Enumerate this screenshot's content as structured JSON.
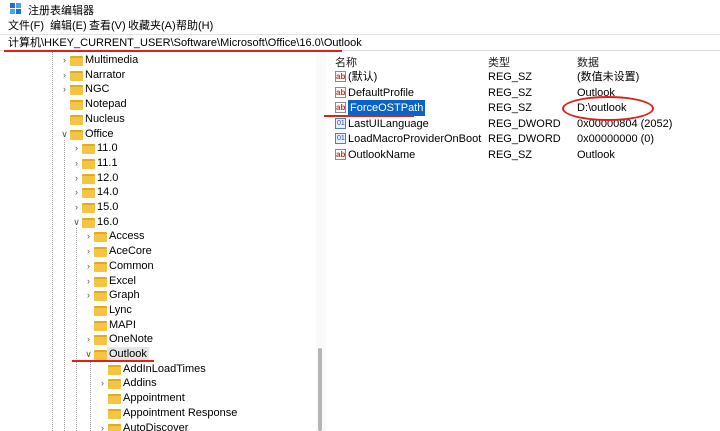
{
  "window": {
    "title": "注册表编辑器"
  },
  "menu": [
    "文件(F)",
    "编辑(E)",
    "查看(V)",
    "收藏夹(A)",
    "帮助(H)"
  ],
  "address": {
    "path": "计算机\\HKEY_CURRENT_USER\\Software\\Microsoft\\Office\\16.0\\Outlook"
  },
  "tree": {
    "items": [
      {
        "label": "Multimedia",
        "level": 0,
        "expanded": false,
        "has_children": true
      },
      {
        "label": "Narrator",
        "level": 0,
        "expanded": false,
        "has_children": true
      },
      {
        "label": "NGC",
        "level": 0,
        "expanded": false,
        "has_children": true
      },
      {
        "label": "Notepad",
        "level": 0,
        "expanded": false,
        "has_children": false
      },
      {
        "label": "Nucleus",
        "level": 0,
        "expanded": false,
        "has_children": false
      },
      {
        "label": "Office",
        "level": 0,
        "expanded": true,
        "has_children": true
      },
      {
        "label": "11.0",
        "level": 1,
        "expanded": false,
        "has_children": true
      },
      {
        "label": "11.1",
        "level": 1,
        "expanded": false,
        "has_children": true
      },
      {
        "label": "12.0",
        "level": 1,
        "expanded": false,
        "has_children": true
      },
      {
        "label": "14.0",
        "level": 1,
        "expanded": false,
        "has_children": true
      },
      {
        "label": "15.0",
        "level": 1,
        "expanded": false,
        "has_children": true
      },
      {
        "label": "16.0",
        "level": 1,
        "expanded": true,
        "has_children": true
      },
      {
        "label": "Access",
        "level": 2,
        "expanded": false,
        "has_children": true
      },
      {
        "label": "AceCore",
        "level": 2,
        "expanded": false,
        "has_children": true
      },
      {
        "label": "Common",
        "level": 2,
        "expanded": false,
        "has_children": true
      },
      {
        "label": "Excel",
        "level": 2,
        "expanded": false,
        "has_children": true
      },
      {
        "label": "Graph",
        "level": 2,
        "expanded": false,
        "has_children": true
      },
      {
        "label": "Lync",
        "level": 2,
        "expanded": false,
        "has_children": false
      },
      {
        "label": "MAPI",
        "level": 2,
        "expanded": false,
        "has_children": false
      },
      {
        "label": "OneNote",
        "level": 2,
        "expanded": false,
        "has_children": true
      },
      {
        "label": "Outlook",
        "level": 2,
        "expanded": true,
        "has_children": true,
        "selected": true
      },
      {
        "label": "AddInLoadTimes",
        "level": 3,
        "expanded": false,
        "has_children": false
      },
      {
        "label": "Addins",
        "level": 3,
        "expanded": false,
        "has_children": true
      },
      {
        "label": "Appointment",
        "level": 3,
        "expanded": false,
        "has_children": false
      },
      {
        "label": "Appointment Response",
        "level": 3,
        "expanded": false,
        "has_children": false
      },
      {
        "label": "AutoDiscover",
        "level": 3,
        "expanded": false,
        "has_children": true
      }
    ]
  },
  "values": {
    "headers": {
      "name": "名称",
      "type": "类型",
      "data": "数据"
    },
    "rows": [
      {
        "name": "(默认)",
        "type": "REG_SZ",
        "data": "(数值未设置)",
        "icon": "string-value-icon"
      },
      {
        "name": "DefaultProfile",
        "type": "REG_SZ",
        "data": "Outlook",
        "icon": "string-value-icon"
      },
      {
        "name": "ForceOSTPath",
        "type": "REG_SZ",
        "data": "D:\\outlook",
        "icon": "string-value-icon",
        "selected": true
      },
      {
        "name": "LastUILanguage",
        "type": "REG_DWORD",
        "data": "0x00000804 (2052)",
        "icon": "binary-value-icon"
      },
      {
        "name": "LoadMacroProviderOnBoot",
        "type": "REG_DWORD",
        "data": "0x00000000 (0)",
        "icon": "binary-value-icon"
      },
      {
        "name": "OutlookName",
        "type": "REG_SZ",
        "data": "Outlook",
        "icon": "string-value-icon"
      }
    ]
  },
  "colors": {
    "annotation": "#e0201c",
    "selection": "#0a64c8",
    "folder": "#f4c542"
  }
}
